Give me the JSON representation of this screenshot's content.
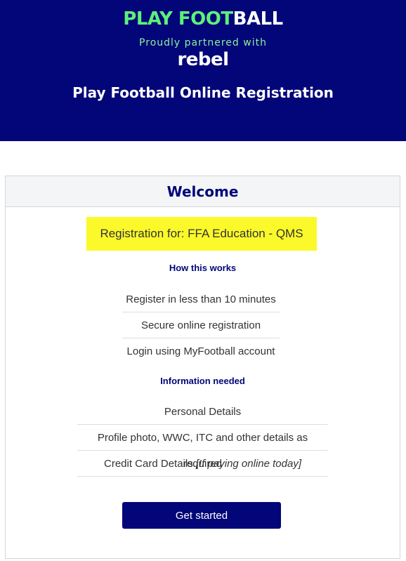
{
  "header": {
    "logo_part1": "PLAY FOOT",
    "logo_part2": "BALL",
    "partner_text": "Proudly partnered with",
    "partner_brand": "rebel",
    "page_title": "Play Football Online Registration"
  },
  "card": {
    "title": "Welcome",
    "registration_label": "Registration for: FFA Education - QMS",
    "how_heading": "How this works",
    "how_items": [
      "Register in less than 10 minutes",
      "Secure online registration",
      "Login using MyFootball account"
    ],
    "info_heading": "Information needed",
    "info_items": [
      "Personal Details",
      "Profile photo, WWC, ITC and other details as required",
      "Credit Card Details"
    ],
    "info_item_note": "[If paying online today]",
    "cta_label": "Get started"
  },
  "colors": {
    "navy": "#020678",
    "green": "#5ef07a",
    "highlight": "#fbf92a"
  }
}
